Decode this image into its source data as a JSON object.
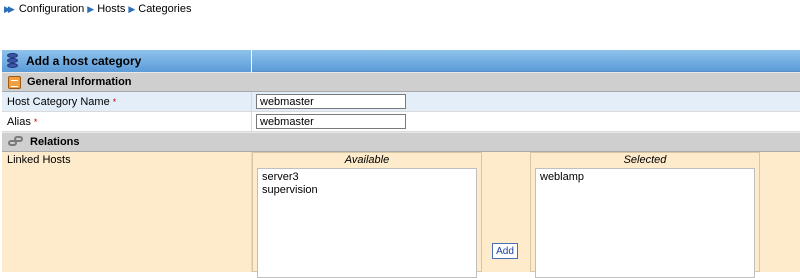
{
  "breadcrumb": {
    "items": [
      "Configuration",
      "Hosts",
      "Categories"
    ]
  },
  "form": {
    "title": "Add a host category",
    "sections": {
      "general": "General Information",
      "relations": "Relations"
    },
    "fields": {
      "name_label": "Host Category Name",
      "name_value": "webmaster",
      "alias_label": "Alias",
      "alias_value": "webmaster",
      "required_mark": "*"
    },
    "linked_hosts": {
      "label": "Linked Hosts",
      "available_header": "Available",
      "selected_header": "Selected",
      "available": [
        "server3",
        "supervision"
      ],
      "selected": [
        "weblamp"
      ],
      "add_label": "Add"
    }
  },
  "colors": {
    "header_blue": "#5c9bd8",
    "section_gray": "#cfcfcf",
    "row_blue": "#e4eef9",
    "relations_bg": "#fdebcb",
    "required_red": "#cc0000"
  }
}
